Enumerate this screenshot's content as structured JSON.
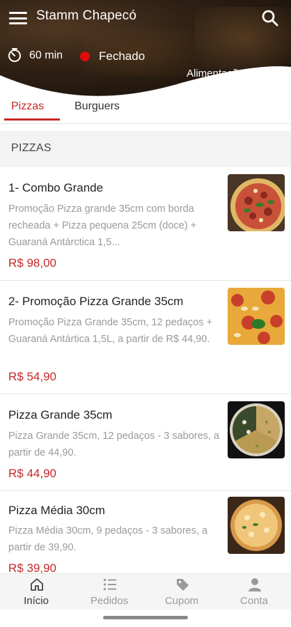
{
  "header": {
    "store_name": "Stamm Chapecó",
    "delivery_time": "60 min",
    "status": "Fechado",
    "status_color": "#e00b0b",
    "category": "Alimentação"
  },
  "tabs": [
    {
      "label": "Pizzas",
      "active": true
    },
    {
      "label": "Burguers",
      "active": false
    }
  ],
  "section": {
    "title": "PIZZAS"
  },
  "products": [
    {
      "name": "1- Combo Grande",
      "description": "Promoção Pizza grande 35cm com borda recheada + Pizza pequena 25cm (doce) + Guaraná Antárctica 1,5...",
      "price": "R$ 98,00"
    },
    {
      "name": "2- Promoção Pizza Grande 35cm",
      "description": "Promoção Pizza Grande 35cm, 12 pedaços + Guaraná Antártica 1,5L, a partir de R$ 44,90.",
      "price": "R$ 54,90"
    },
    {
      "name": "Pizza Grande 35cm",
      "description": "Pizza Grande 35cm, 12 pedaços - 3 sabores, a partir de 44,90.",
      "price": "R$ 44,90"
    },
    {
      "name": "Pizza Média 30cm",
      "description": "Pizza Média 30cm, 9 pedaços - 3 sabores, a partir de 39,90.",
      "price": "R$ 39,90"
    }
  ],
  "bottom_nav": [
    {
      "label": "Início",
      "icon": "home-icon",
      "active": true
    },
    {
      "label": "Pedidos",
      "icon": "list-icon",
      "active": false
    },
    {
      "label": "Cupom",
      "icon": "tag-icon",
      "active": false
    },
    {
      "label": "Conta",
      "icon": "person-icon",
      "active": false
    }
  ],
  "colors": {
    "accent": "#c62828",
    "muted": "#9a9a9a"
  }
}
